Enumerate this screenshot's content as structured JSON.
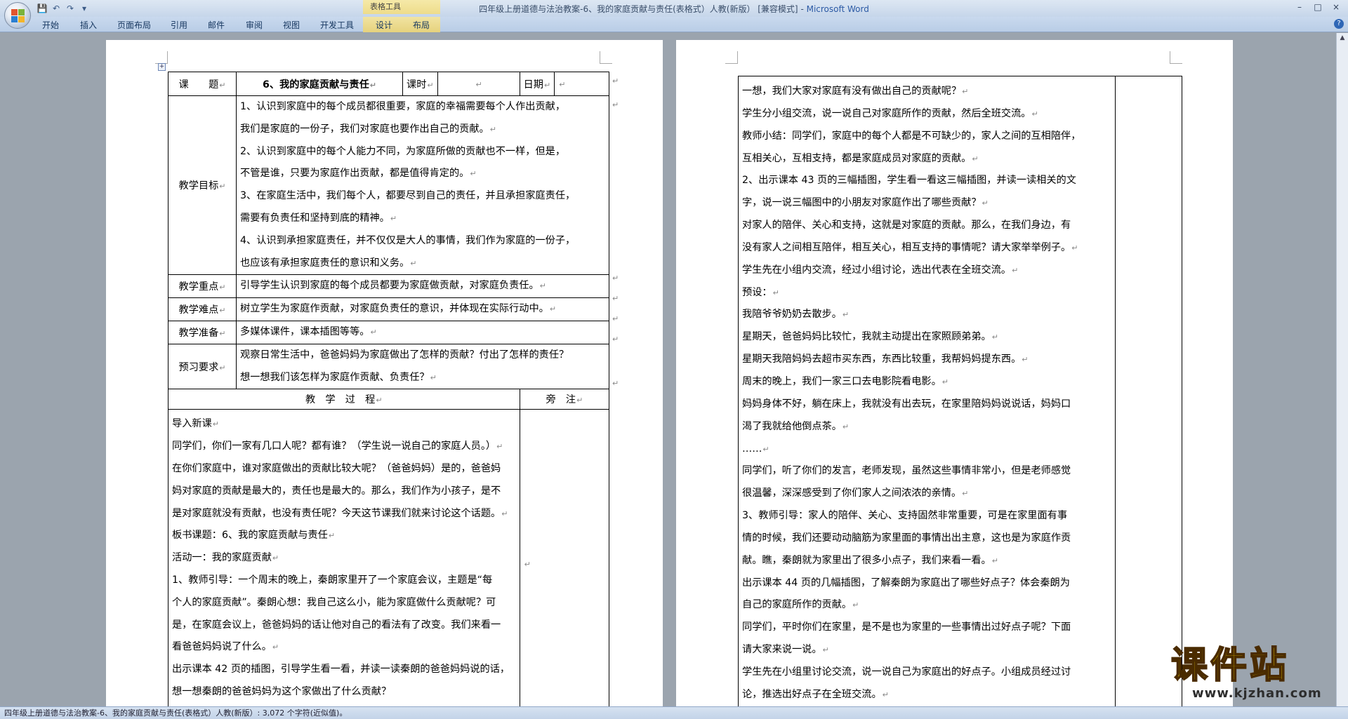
{
  "window": {
    "title": "四年级上册道德与法治教案-6、我的家庭贡献与责任(表格式）人教(新版）  [兼容模式]",
    "app_name": "Microsoft Word",
    "controls": [
      "–",
      "□",
      "×"
    ]
  },
  "qat": {
    "save": "💾",
    "undo": "↶",
    "redo": "↷",
    "more": "▾"
  },
  "ribbon": {
    "context_group": "表格工具",
    "tabs": [
      "开始",
      "插入",
      "页面布局",
      "引用",
      "邮件",
      "审阅",
      "视图",
      "开发工具",
      "设计",
      "布局"
    ],
    "help": "?"
  },
  "doc": {
    "mark": "↵",
    "row_keti": {
      "label": "课　　题",
      "title": "6、我的家庭贡献与责任",
      "keshi": "课时",
      "riqi": "日期"
    },
    "objectives_label": "教学目标",
    "objectives": [
      "1、认识到家庭中的每个成员都很重要，家庭的幸福需要每个人作出贡献，",
      "我们是家庭的一份子，我们对家庭也要作出自己的贡献。",
      "2、认识到家庭中的每个人能力不同，为家庭所做的贡献也不一样，但是，",
      "不管是谁，只要为家庭作出贡献，都是值得肯定的。",
      "3、在家庭生活中，我们每个人，都要尽到自己的责任，并且承担家庭责任，",
      "需要有负责任和坚持到底的精神。",
      "4、认识到承担家庭责任，并不仅仅是大人的事情，我们作为家庭的一份子，",
      "也应该有承担家庭责任的意识和义务。"
    ],
    "key_label": "教学重点",
    "key_text": "引导学生认识到家庭的每个成员都要为家庭做贡献，对家庭负责任。",
    "difficult_label": "教学难点",
    "difficult_text": "树立学生为家庭作贡献，对家庭负责任的意识，并体现在实际行动中。",
    "prep_label": "教学准备",
    "prep_text": "多媒体课件，课本插图等等。",
    "preview_label": "预习要求",
    "preview_lines": [
      "观察日常生活中，爸爸妈妈为家庭做出了怎样的贡献？付出了怎样的责任？",
      "想一想我们该怎样为家庭作贡献、负责任？"
    ],
    "process_header": "教　学　过　程",
    "notes_header": "旁　注",
    "left_process": [
      "导入新课",
      "同学们，你们一家有几口人呢？都有谁？（学生说一说自己的家庭人员。）",
      "在你们家庭中，谁对家庭做出的贡献比较大呢？（爸爸妈妈）是的，爸爸妈",
      "妈对家庭的贡献是最大的，责任也是最大的。那么，我们作为小孩子，是不",
      "是对家庭就没有贡献，也没有责任呢？今天这节课我们就来讨论这个话题。",
      "板书课题：6、我的家庭贡献与责任",
      "活动一：我的家庭贡献",
      "1、教师引导：一个周末的晚上，秦朗家里开了一个家庭会议，主题是“每",
      "个人的家庭贡献”。秦朗心想：我自己这么小，能为家庭做什么贡献呢？可",
      "是，在家庭会议上，爸爸妈妈的话让他对自己的看法有了改变。我们来看一",
      "看爸爸妈妈说了什么。",
      "出示课本 42 页的插图，引导学生看一看，并读一读秦朗的爸爸妈妈说的话，",
      "想一想秦朗的爸爸妈妈为这个家做出了什么贡献？"
    ],
    "right_process": [
      "一想，我们大家对家庭有没有做出自己的贡献呢？",
      "学生分小组交流，说一说自己对家庭所作的贡献，然后全班交流。",
      "教师小结：同学们，家庭中的每个人都是不可缺少的，家人之间的互相陪伴，",
      "互相关心，互相支持，都是家庭成员对家庭的贡献。",
      "2、出示课本 43 页的三幅插图，学生看一看这三幅插图，并读一读相关的文",
      "字，说一说三幅图中的小朋友对家庭作出了哪些贡献？",
      "对家人的陪伴、关心和支持，这就是对家庭的贡献。那么，在我们身边，有",
      "没有家人之间相互陪伴，相互关心，相互支持的事情呢？请大家举举例子。",
      "学生先在小组内交流，经过小组讨论，选出代表在全班交流。",
      "预设：",
      "我陪爷爷奶奶去散步。",
      "星期天，爸爸妈妈比较忙，我就主动提出在家照顾弟弟。",
      "星期天我陪妈妈去超市买东西，东西比较重，我帮妈妈提东西。",
      "周末的晚上，我们一家三口去电影院看电影。",
      "妈妈身体不好，躺在床上，我就没有出去玩，在家里陪妈妈说说话，妈妈口",
      "渴了我就给他倒点茶。",
      "……",
      "同学们，听了你们的发言，老师发现，虽然这些事情非常小，但是老师感觉",
      "很温馨，深深感受到了你们家人之间浓浓的亲情。",
      "3、教师引导：家人的陪伴、关心、支持固然非常重要，可是在家里面有事",
      "情的时候，我们还要动动脑筋为家里面的事情出出主意，这也是为家庭作贡",
      "献。瞧，秦朗就为家里出了很多小点子，我们来看一看。",
      "出示课本 44 页的几幅插图，了解秦朗为家庭出了哪些好点子？体会秦朗为",
      "自己的家庭所作的贡献。",
      "同学们，平时你们在家里，是不是也为家里的一些事情出过好点子呢？下面",
      "请大家来说一说。",
      "学生先在小组里讨论交流，说一说自己为家庭出的好点子。小组成员经过讨",
      "论，推选出好点子在全班交流。"
    ]
  },
  "statusbar": {
    "text": "四年级上册道德与法治教案-6、我的家庭贡献与责任(表格式）人教(新版）: 3,072 个字符(近似值)。"
  },
  "watermark": {
    "main": "课件站",
    "url": "www.kjzhan.com"
  }
}
